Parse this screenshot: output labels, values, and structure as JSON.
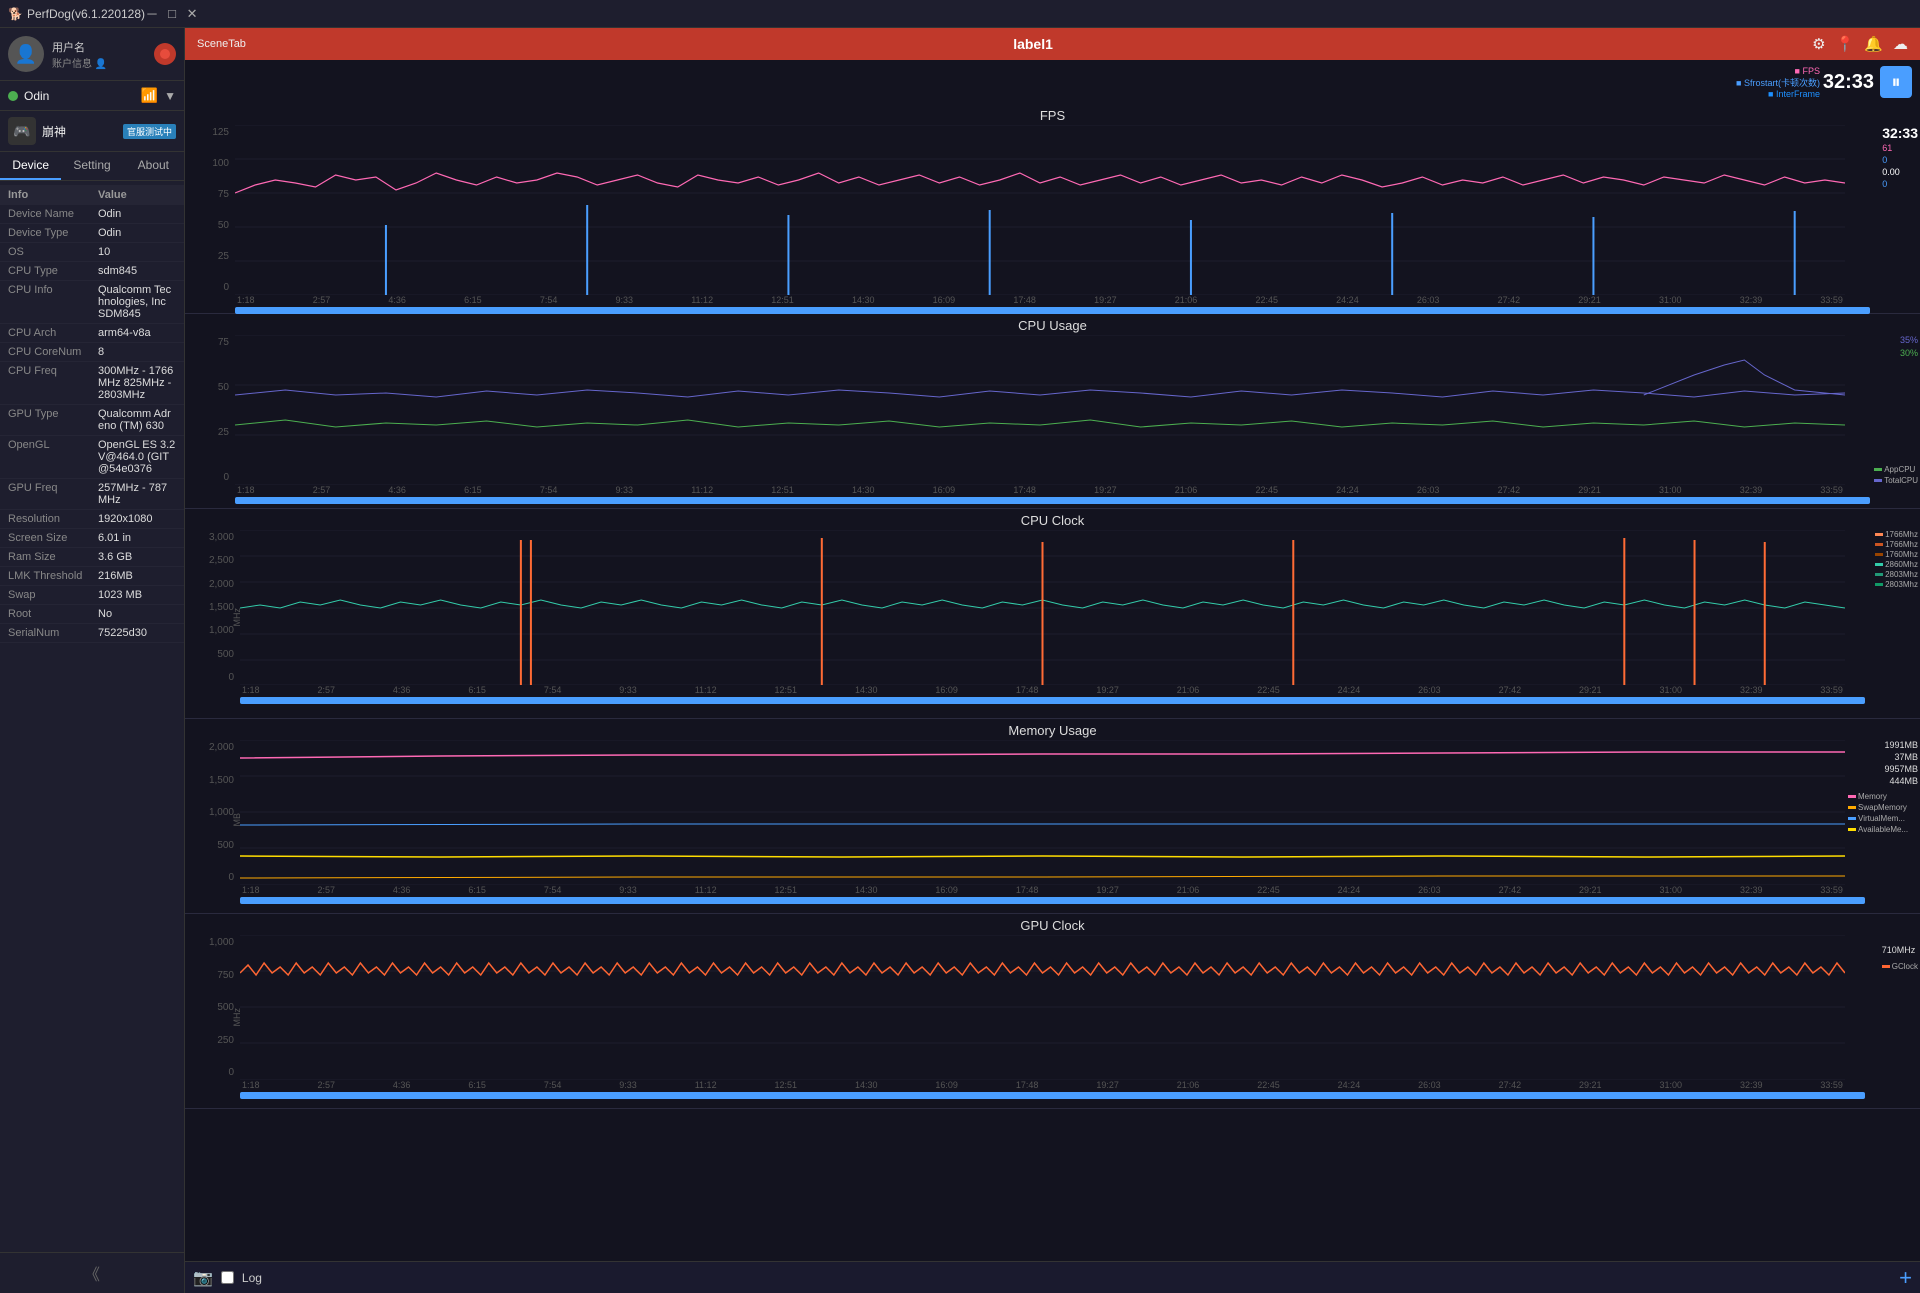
{
  "titlebar": {
    "title": "PerfDog(v6.1.220128)",
    "controls": [
      "─",
      "□",
      "✕"
    ]
  },
  "sidebar": {
    "user": {
      "name": "用户名",
      "sub": "账户信息",
      "avatar_icon": "👤"
    },
    "device": {
      "name": "Odin",
      "status": "connected"
    },
    "game": {
      "name": "崩神",
      "tag": "官服测试中"
    },
    "tabs": [
      {
        "label": "Device",
        "active": true
      },
      {
        "label": "Setting",
        "active": false
      },
      {
        "label": "About",
        "active": false
      }
    ],
    "info_header": {
      "label": "Info",
      "value": "Value"
    },
    "info_rows": [
      {
        "label": "Device Name",
        "value": "Odin"
      },
      {
        "label": "Device Type",
        "value": "Odin"
      },
      {
        "label": "OS",
        "value": "10"
      },
      {
        "label": "CPU Type",
        "value": "sdm845"
      },
      {
        "label": "CPU Info",
        "value": "Qualcomm Technologies, Inc SDM845"
      },
      {
        "label": "CPU Arch",
        "value": "arm64-v8a"
      },
      {
        "label": "CPU CoreNum",
        "value": "8"
      },
      {
        "label": "CPU Freq",
        "value": "300MHz - 1766MHz\n825MHz - 2803MHz"
      },
      {
        "label": "GPU Type",
        "value": "Qualcomm Adreno (TM) 630"
      },
      {
        "label": "OpenGL",
        "value": "OpenGL ES 3.2 V@464.0 (GIT@54e0376"
      },
      {
        "label": "GPU Freq",
        "value": "257MHz - 787MHz"
      },
      {
        "label": "Resolution",
        "value": "1920x1080"
      },
      {
        "label": "Screen Size",
        "value": "6.01 in"
      },
      {
        "label": "Ram Size",
        "value": "3.6 GB"
      },
      {
        "label": "LMK Threshold",
        "value": "216MB"
      },
      {
        "label": "Swap",
        "value": "1023 MB"
      },
      {
        "label": "Root",
        "value": "No"
      },
      {
        "label": "SerialNum",
        "value": "75225d30"
      }
    ]
  },
  "main": {
    "scene_tab": "SceneTab",
    "scene_label": "label1",
    "time_display": "32:33",
    "charts": [
      {
        "id": "fps",
        "title": "FPS",
        "y_max": 125,
        "y_labels": [
          "125",
          "100",
          "75",
          "50",
          "25",
          "0"
        ],
        "legend": [
          {
            "color": "#ff69b4",
            "label": "FPS",
            "value": ""
          },
          {
            "color": "#4a9eff",
            "label": "Sfrostart(卡顿次数)",
            "value": ""
          },
          {
            "color": "#1e90ff",
            "label": "InterFrame",
            "value": ""
          }
        ],
        "right_values": [
          "32:33",
          "61",
          "0",
          "0.00",
          "0"
        ],
        "x_labels": [
          "1:18",
          "2:57",
          "4:36",
          "6:15",
          "7:54",
          "9:33",
          "11:12",
          "12:51",
          "14:30",
          "16:09",
          "17:48",
          "19:27",
          "21:06",
          "22:45",
          "24:24",
          "26:03",
          "27:42",
          "29:21",
          "31:00",
          "32:39",
          "33:59"
        ]
      },
      {
        "id": "cpu-usage",
        "title": "CPU Usage",
        "y_max": 75,
        "y_labels": [
          "75",
          "50",
          "25",
          "0"
        ],
        "legend": [
          {
            "color": "#4CAF50",
            "label": "AppCPU",
            "value": ""
          },
          {
            "color": "#6666cc",
            "label": "TotalCPU",
            "value": ""
          }
        ],
        "right_values": [
          "35%",
          "30%"
        ],
        "x_labels": [
          "1:18",
          "2:57",
          "4:36",
          "6:15",
          "7:54",
          "9:33",
          "11:12",
          "12:51",
          "14:30",
          "16:09",
          "17:48",
          "19:27",
          "21:06",
          "22:45",
          "24:24",
          "26:03",
          "27:42",
          "29:21",
          "31:00",
          "32:39",
          "33:59"
        ]
      },
      {
        "id": "cpu-clock",
        "title": "CPU Clock",
        "y_max": 3000,
        "y_labels": [
          "3,000",
          "2,500",
          "2,000",
          "1,500",
          "1,000",
          "500",
          "0"
        ],
        "legend": [
          {
            "color": "#ff6b35",
            "label": "1766Mhz",
            "value": ""
          },
          {
            "color": "#cc4400",
            "label": "1766Mhz",
            "value": ""
          },
          {
            "color": "#994400",
            "label": "1760Mhz",
            "value": ""
          },
          {
            "color": "#33ccaa",
            "label": "2860Mhz",
            "value": ""
          },
          {
            "color": "#229977",
            "label": "2803Mhz",
            "value": ""
          },
          {
            "color": "#119966",
            "label": "2803Mhz",
            "value": ""
          }
        ],
        "x_labels": [
          "1:18",
          "2:57",
          "4:36",
          "6:15",
          "7:54",
          "9:33",
          "11:12",
          "12:51",
          "14:30",
          "16:09",
          "17:48",
          "19:27",
          "21:06",
          "22:45",
          "24:24",
          "26:03",
          "27:42",
          "29:21",
          "31:00",
          "32:39",
          "33:59"
        ],
        "unit": "MHz"
      },
      {
        "id": "memory-usage",
        "title": "Memory Usage",
        "y_max": 2000,
        "y_labels": [
          "2,000",
          "1,500",
          "1,000",
          "500",
          "0"
        ],
        "legend": [
          {
            "color": "#ff69b4",
            "label": "Memory",
            "value": "1991MB"
          },
          {
            "color": "#ffaa00",
            "label": "SwapMemory",
            "value": "37MB"
          },
          {
            "color": "#4a9eff",
            "label": "VirtualMem...",
            "value": "9957MB"
          },
          {
            "color": "#ffdd00",
            "label": "AvailableMe...",
            "value": "444MB"
          }
        ],
        "x_labels": [
          "1:18",
          "2:57",
          "4:36",
          "6:15",
          "7:54",
          "9:33",
          "11:12",
          "12:51",
          "14:30",
          "16:09",
          "17:48",
          "19:27",
          "21:06",
          "22:45",
          "24:24",
          "26:03",
          "27:42",
          "29:21",
          "31:00",
          "32:39",
          "33:59"
        ],
        "unit": "MB"
      },
      {
        "id": "gpu-clock",
        "title": "GPU Clock",
        "y_max": 1000,
        "y_labels": [
          "1,000",
          "750",
          "500",
          "250",
          "0"
        ],
        "legend": [
          {
            "color": "#ff6633",
            "label": "GClock",
            "value": "710MHz"
          }
        ],
        "x_labels": [
          "1:18",
          "2:57",
          "4:36",
          "6:15",
          "7:54",
          "9:33",
          "11:12",
          "12:51",
          "14:30",
          "16:09",
          "17:48",
          "19:27",
          "21:06",
          "22:45",
          "24:24",
          "26:03",
          "27:42",
          "29:21",
          "31:00",
          "32:39",
          "33:59"
        ],
        "unit": "MHz"
      }
    ]
  },
  "bottom": {
    "screenshot_icon": "📷",
    "log_label": "Log",
    "expand_icon": "+"
  }
}
